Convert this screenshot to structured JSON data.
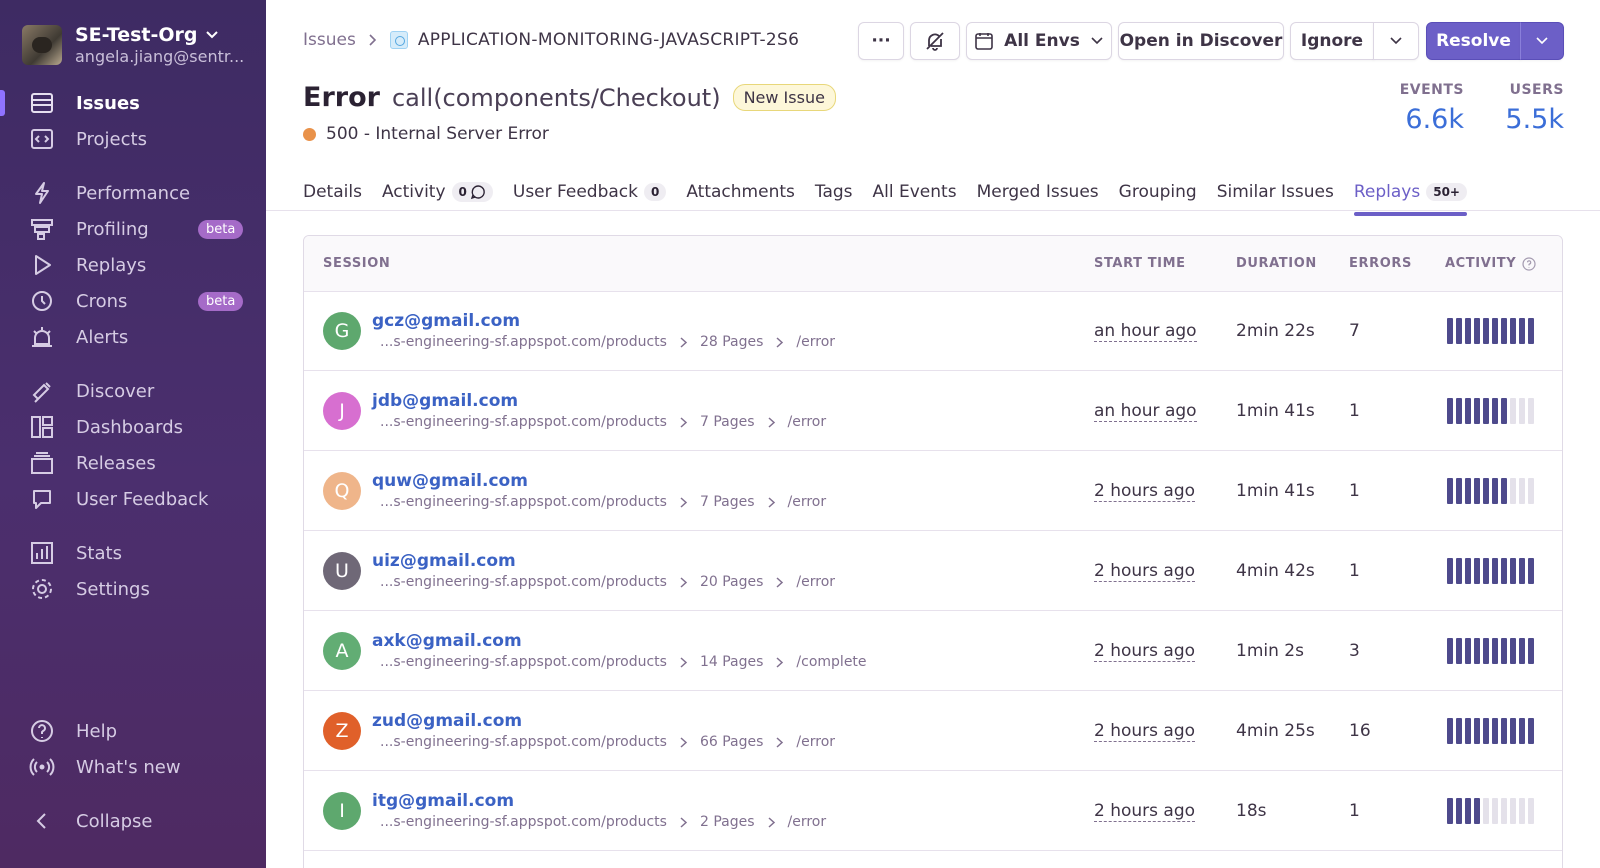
{
  "sidebar": {
    "org_name": "SE-Test-Org",
    "org_email": "angela.jiang@sentr...",
    "items": [
      {
        "label": "Issues",
        "icon": "issues-icon",
        "active": true
      },
      {
        "label": "Projects",
        "icon": "projects-icon"
      },
      {
        "label": "Performance",
        "icon": "performance-icon"
      },
      {
        "label": "Profiling",
        "icon": "profiling-icon",
        "badge": "beta"
      },
      {
        "label": "Replays",
        "icon": "replays-icon"
      },
      {
        "label": "Crons",
        "icon": "crons-icon",
        "badge": "beta"
      },
      {
        "label": "Alerts",
        "icon": "alerts-icon"
      },
      {
        "label": "Discover",
        "icon": "discover-icon"
      },
      {
        "label": "Dashboards",
        "icon": "dashboards-icon"
      },
      {
        "label": "Releases",
        "icon": "releases-icon"
      },
      {
        "label": "User Feedback",
        "icon": "user-feedback-icon"
      },
      {
        "label": "Stats",
        "icon": "stats-icon"
      },
      {
        "label": "Settings",
        "icon": "settings-icon"
      },
      {
        "label": "Help",
        "icon": "help-icon"
      },
      {
        "label": "What's new",
        "icon": "broadcast-icon"
      },
      {
        "label": "Collapse",
        "icon": "collapse-icon"
      }
    ]
  },
  "breadcrumb": {
    "root": "Issues",
    "issue_id": "APPLICATION-MONITORING-JAVASCRIPT-2S6"
  },
  "toolbar": {
    "more_label": "···",
    "env_label": "All Envs",
    "discover_label": "Open in Discover",
    "ignore_label": "Ignore",
    "resolve_label": "Resolve"
  },
  "issue": {
    "type": "Error",
    "culprit": "call(components/Checkout)",
    "badge": "New Issue",
    "message": "500 - Internal Server Error",
    "status_color": "#e9924a"
  },
  "stats": {
    "events_label": "EVENTS",
    "events_value": "6.6k",
    "users_label": "USERS",
    "users_value": "5.5k"
  },
  "tabs": {
    "details": "Details",
    "activity": "Activity",
    "activity_count": "0",
    "user_feedback": "User Feedback",
    "user_feedback_count": "0",
    "attachments": "Attachments",
    "tags": "Tags",
    "all_events": "All Events",
    "merged": "Merged Issues",
    "grouping": "Grouping",
    "similar": "Similar Issues",
    "replays": "Replays",
    "replays_count": "50+"
  },
  "table": {
    "headers": {
      "session": "SESSION",
      "start_time": "START TIME",
      "duration": "DURATION",
      "errors": "ERRORS",
      "activity": "ACTIVITY"
    },
    "rows": [
      {
        "initial": "G",
        "color": "#5ea86e",
        "email": "gcz@gmail.com",
        "url": "...s-engineering-sf.appspot.com/products",
        "pages": "28 Pages",
        "last": "/error",
        "start": "an hour ago",
        "duration": "2min 22s",
        "errors": "7",
        "activity": 10
      },
      {
        "initial": "J",
        "color": "#d76fd0",
        "email": "jdb@gmail.com",
        "url": "...s-engineering-sf.appspot.com/products",
        "pages": "7 Pages",
        "last": "/error",
        "start": "an hour ago",
        "duration": "1min 41s",
        "errors": "1",
        "activity": 7
      },
      {
        "initial": "Q",
        "color": "#efb58a",
        "email": "quw@gmail.com",
        "url": "...s-engineering-sf.appspot.com/products",
        "pages": "7 Pages",
        "last": "/error",
        "start": "2 hours ago",
        "duration": "1min 41s",
        "errors": "1",
        "activity": 7
      },
      {
        "initial": "U",
        "color": "#6f6877",
        "email": "uiz@gmail.com",
        "url": "...s-engineering-sf.appspot.com/products",
        "pages": "20 Pages",
        "last": "/error",
        "start": "2 hours ago",
        "duration": "4min 42s",
        "errors": "1",
        "activity": 10
      },
      {
        "initial": "A",
        "color": "#62ad74",
        "email": "axk@gmail.com",
        "url": "...s-engineering-sf.appspot.com/products",
        "pages": "14 Pages",
        "last": "/complete",
        "start": "2 hours ago",
        "duration": "1min 2s",
        "errors": "3",
        "activity": 10
      },
      {
        "initial": "Z",
        "color": "#e0602a",
        "email": "zud@gmail.com",
        "url": "...s-engineering-sf.appspot.com/products",
        "pages": "66 Pages",
        "last": "/error",
        "start": "2 hours ago",
        "duration": "4min 25s",
        "errors": "16",
        "activity": 10
      },
      {
        "initial": "I",
        "color": "#5ea86e",
        "email": "itg@gmail.com",
        "url": "...s-engineering-sf.appspot.com/products",
        "pages": "2 Pages",
        "last": "/error",
        "start": "2 hours ago",
        "duration": "18s",
        "errors": "1",
        "activity": 4
      }
    ]
  }
}
